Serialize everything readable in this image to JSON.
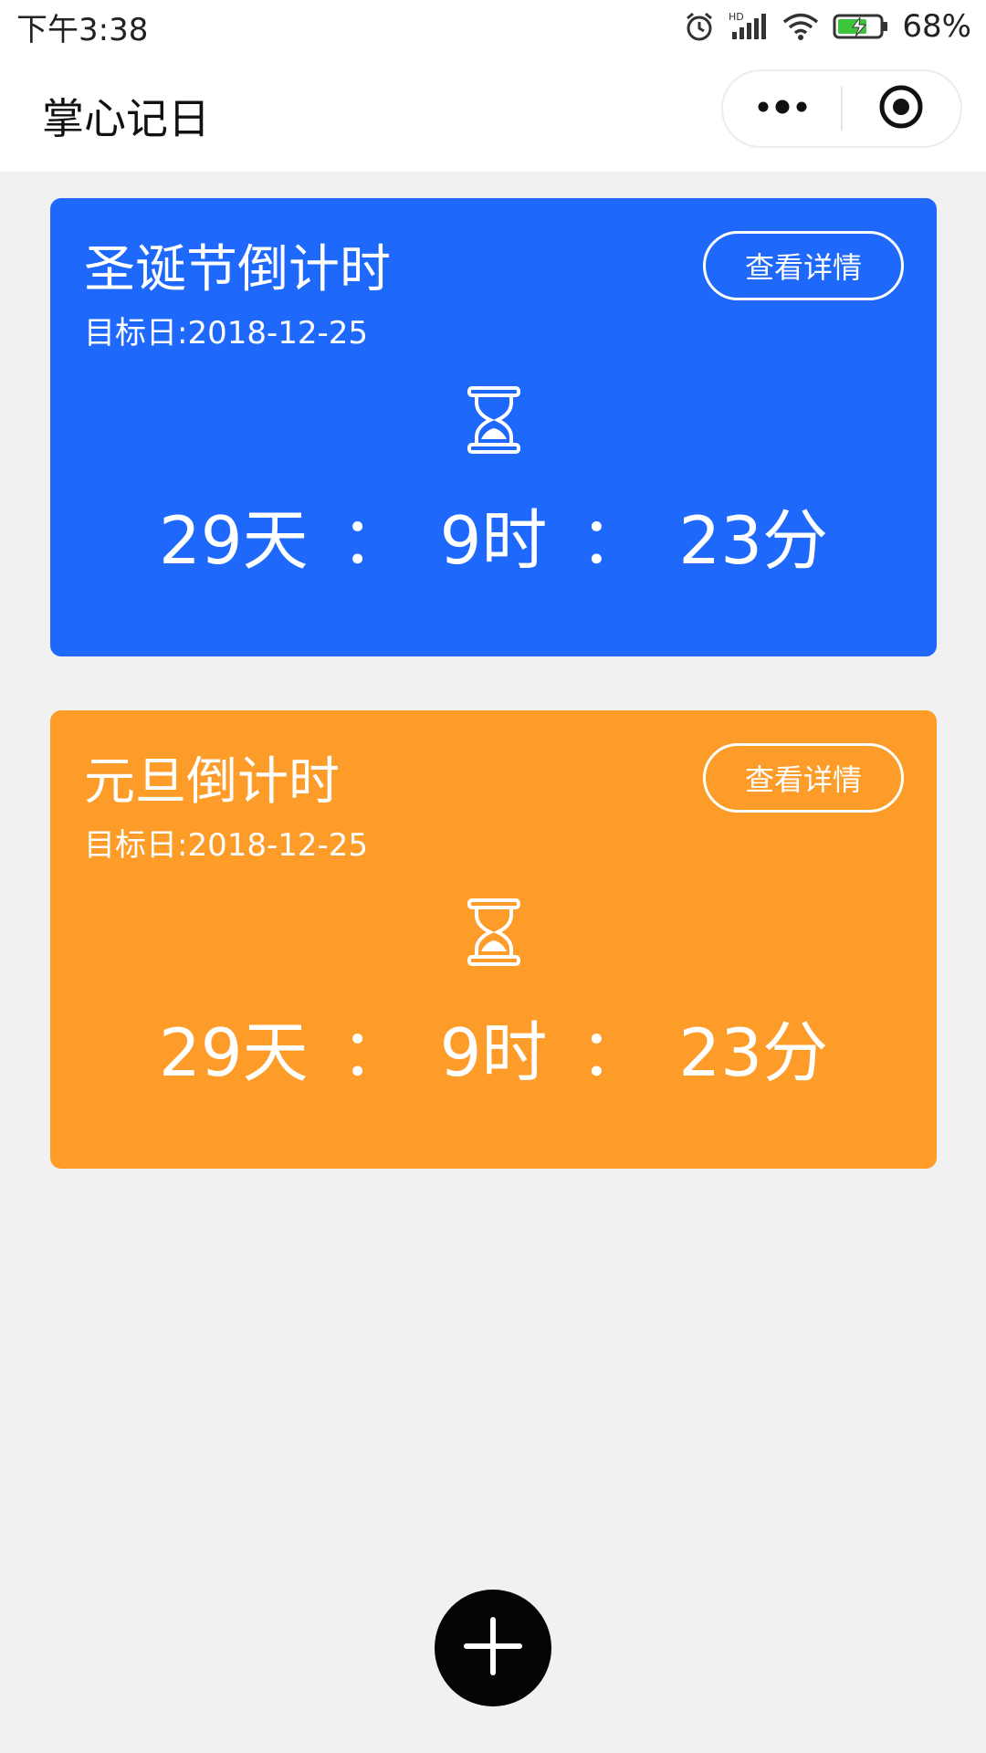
{
  "status_bar": {
    "time": "下午3:38",
    "battery_percent": "68%",
    "battery_level": 0.68,
    "icons": [
      "alarm-icon",
      "hd-signal-icon",
      "wifi-icon",
      "battery-charging-icon"
    ]
  },
  "nav": {
    "title": "掌心记日",
    "menu_icon": "more-dots-icon",
    "close_icon": "target-circle-icon"
  },
  "cards": [
    {
      "title": "圣诞节倒计时",
      "target": "目标日:2018-12-25",
      "detail_label": "查看详情",
      "days": "29天",
      "hours": "9时",
      "minutes": "23分",
      "separator": "：",
      "color": "#1e69fb",
      "icon": "hourglass-icon"
    },
    {
      "title": "元旦倒计时",
      "target": "目标日:2018-12-25",
      "detail_label": "查看详情",
      "days": "29天",
      "hours": "9时",
      "minutes": "23分",
      "separator": "：",
      "color": "#fd9c29",
      "icon": "hourglass-icon"
    }
  ],
  "fab": {
    "icon": "plus-icon",
    "color": "#050505"
  }
}
